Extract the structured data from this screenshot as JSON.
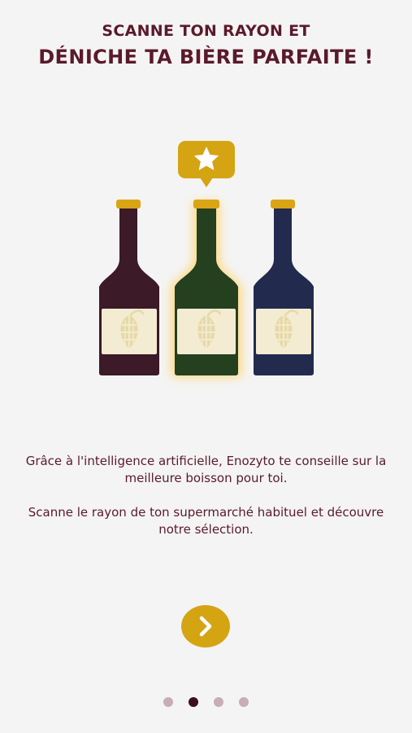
{
  "header": {
    "title_line1": "SCANNE TON RAYON ET",
    "title_line2": "DÉNICHE TA BIÈRE PARFAITE !"
  },
  "illustration": {
    "bottles": [
      {
        "name": "bottle-dark-red",
        "color": "#3c1a28",
        "highlighted": false
      },
      {
        "name": "bottle-green",
        "color": "#24401f",
        "highlighted": true
      },
      {
        "name": "bottle-navy",
        "color": "#222a4e",
        "highlighted": false
      }
    ],
    "badge_icon": "star-icon",
    "label_icon": "hop-icon",
    "colors": {
      "cap": "#d9a514",
      "label": "#f3ecd2",
      "hop": "#e6d9a8",
      "badge": "#d4a413",
      "glow": "#ffd36b"
    }
  },
  "description": {
    "paragraph1": "Grâce à l'intelligence artificielle, Enozyto te conseille sur la meilleure boisson pour toi.",
    "paragraph2": "Scanne le rayon de ton supermarché habituel et découvre notre sélection."
  },
  "next_button": {
    "icon": "chevron-right-icon",
    "color": "#d4a413"
  },
  "pagination": {
    "count": 4,
    "active_index": 1,
    "active_color": "#3d0f1e",
    "inactive_color": "#c7aeb3"
  }
}
